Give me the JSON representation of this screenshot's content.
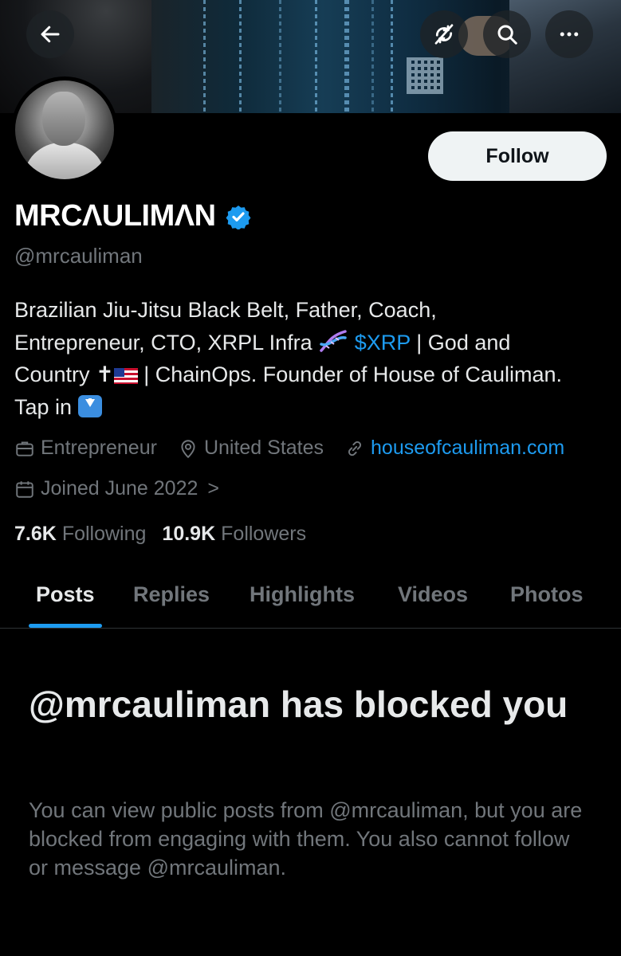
{
  "header": {
    "back_icon": "arrow-left-icon",
    "sync_icon": "sync-off-icon",
    "search_icon": "search-icon",
    "more_icon": "more-horizontal-icon"
  },
  "profile": {
    "follow_label": "Follow",
    "display_name": "MRCΛULIMΛN",
    "handle": "@mrcauliman",
    "bio": {
      "line1": "Brazilian Jiu-Jitsu Black Belt, Father, Coach,",
      "line2_a": "Entrepreneur, CTO, XRPL Infra",
      "line2_link": "$XRP",
      "line2_b": "| God and",
      "line3_a": "Country",
      "line3_cross": "✝",
      "line3_b": "| ChainOps. Founder of House of Cauliman.",
      "line4": "Tap in"
    },
    "profession": "Entrepreneur",
    "location": "United States",
    "website": "houseofcauliman.com",
    "joined": "Joined June 2022",
    "joined_chevron": ">",
    "following_count": "7.6K",
    "following_label": "Following",
    "followers_count": "10.9K",
    "followers_label": "Followers"
  },
  "tabs": [
    {
      "label": "Posts",
      "active": true
    },
    {
      "label": "Replies"
    },
    {
      "label": "Highlights"
    },
    {
      "label": "Videos"
    },
    {
      "label": "Photos"
    }
  ],
  "blocked": {
    "title": "@mrcauliman has blocked you",
    "description": "You can view public posts from @mrcauliman, but you are blocked from engaging with them. You also cannot follow or message @mrcauliman."
  },
  "colors": {
    "background": "#000000",
    "accent": "#1d9bf0",
    "secondary_text": "#71767b",
    "primary_text": "#e7e9ea"
  }
}
